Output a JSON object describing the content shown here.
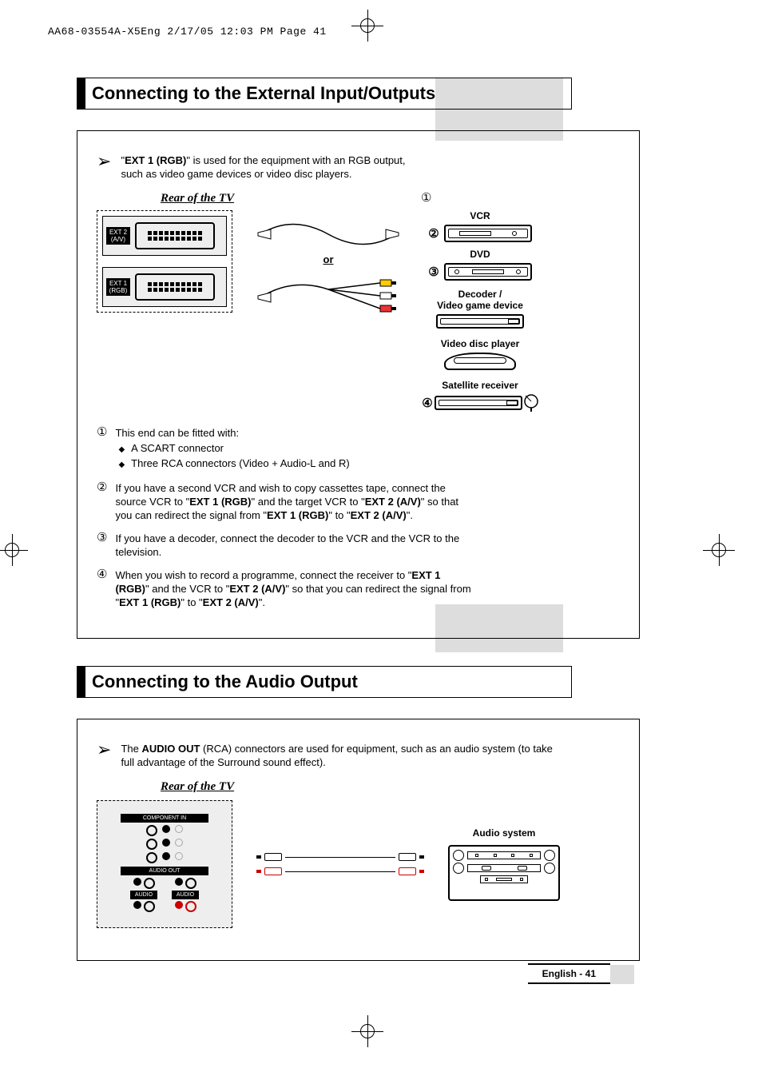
{
  "header": {
    "crop_info": "AA68-03554A-X5Eng  2/17/05  12:03 PM  Page 41"
  },
  "section1": {
    "title": "Connecting to the External Input/Outputs",
    "note_prefix": "\"",
    "note_bold1": "EXT 1 (RGB)",
    "note_text": "\" is used for the equipment with an RGB output, such as video game devices or video disc players.",
    "rear_label": "Rear of the TV",
    "scart1": "EXT 2\n(A/V)",
    "scart2": "EXT 1\n(RGB)",
    "or": "or",
    "n1": "①",
    "n2": "②",
    "n3": "③",
    "n4": "④",
    "devices": {
      "vcr": "VCR",
      "dvd": "DVD",
      "decoder": "Decoder /\nVideo game device",
      "vdp": "Video disc player",
      "sat": "Satellite receiver"
    },
    "items": {
      "i1_lead": "This end can be fitted with:",
      "i1_a": "A SCART connector",
      "i1_b": "Three RCA connectors (Video + Audio-L and R)",
      "i2_a": "If you have a second VCR and wish to copy cassettes tape, connect the source VCR to \"",
      "i2_b1": "EXT 1 (RGB)",
      "i2_c": "\" and the target VCR to \"",
      "i2_b2": "EXT 2 (A/V)",
      "i2_d": "\" so that you can redirect the signal from \"",
      "i2_b3": "EXT 1 (RGB)",
      "i2_e": "\" to \"",
      "i2_b4": "EXT 2 (A/V)",
      "i2_f": "\".",
      "i3": "If you have a decoder, connect the decoder to the VCR and the VCR to the television.",
      "i4_a": "When you wish to record a programme, connect the receiver to \"",
      "i4_b1": "EXT 1 (RGB)",
      "i4_c": "\" and the VCR to \"",
      "i4_b2": "EXT 2 (A/V)",
      "i4_d": "\" so that you can redirect the signal from \"",
      "i4_b3": "EXT 1 (RGB)",
      "i4_e": "\" to \"",
      "i4_b4": "EXT 2 (A/V)",
      "i4_f": "\"."
    }
  },
  "section2": {
    "title": "Connecting to the Audio Output",
    "note_a": "The ",
    "note_bold": "AUDIO OUT",
    "note_b": " (RCA) connectors are used for equipment, such as an audio system (to take full advantage of the Surround sound effect).",
    "rear_label": "Rear of the TV",
    "comp_label": "COMPONENT IN",
    "audio_out_label": "AUDIO OUT",
    "audio_label": "AUDIO",
    "device": "Audio system"
  },
  "footer": {
    "page": "English - 41"
  }
}
